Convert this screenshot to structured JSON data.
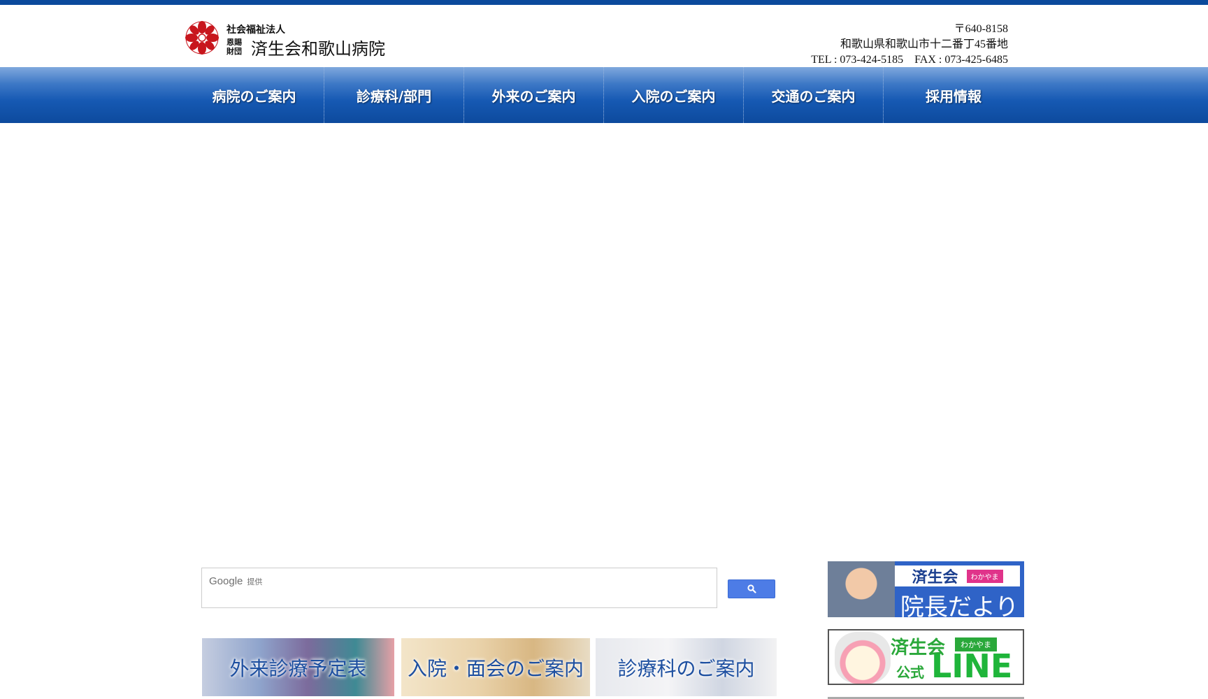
{
  "header": {
    "org_type": "社会福祉法人",
    "stack_line1": "恩賜",
    "stack_line2": "財団",
    "hospital_name": "済生会和歌山病院",
    "postal": "〒640-8158",
    "address": "和歌山県和歌山市十二番丁45番地",
    "tel_fax": "TEL : 073-424-5185　FAX : 073-425-6485"
  },
  "nav": {
    "items": [
      {
        "label": "病院のご案内"
      },
      {
        "label": "診療科/部門"
      },
      {
        "label": "外来のご案内"
      },
      {
        "label": "入院のご案内"
      },
      {
        "label": "交通のご案内"
      },
      {
        "label": "採用情報"
      }
    ]
  },
  "search": {
    "brand": "Google",
    "brand_suffix": "提供",
    "placeholder": "",
    "button_icon": "search-icon"
  },
  "banners": [
    {
      "label": "外来診療予定表"
    },
    {
      "label": "入院・面会のご案内"
    },
    {
      "label": "診療科のご案内"
    }
  ],
  "side_banners": {
    "director": {
      "tag": "済生会",
      "tag_small": "わかやま",
      "title": "院長だより"
    },
    "line": {
      "tag": "済生会",
      "tag_small": "わかやま",
      "sub": "公式",
      "logo": "LINE"
    }
  },
  "colors": {
    "topbar": "#0b4a9c",
    "nav": "#1659b3",
    "search_button": "#4d7ce6",
    "line_green": "#1fb53a"
  }
}
